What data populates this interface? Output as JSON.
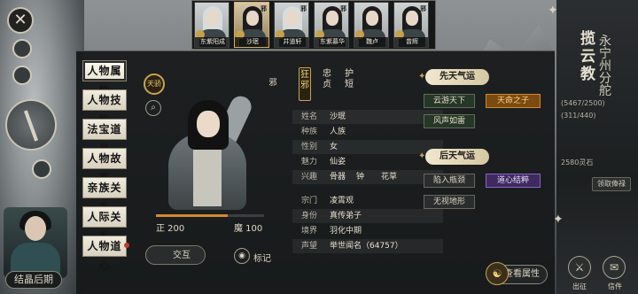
{
  "close_icon": "✕",
  "colors": {
    "gold": "#c8a44f",
    "panel": "#161819",
    "good_fortune": "#263627",
    "orange_fortune": "#7a4a10",
    "purple_fortune": "#3f2a5e"
  },
  "top_bar": {
    "characters": [
      {
        "name": "东紫阳成",
        "badge": "",
        "mark": "",
        "silver": true,
        "active": false
      },
      {
        "name": "沙珉",
        "badge": "",
        "mark": "邪",
        "silver": false,
        "active": true
      },
      {
        "name": "井道轩",
        "badge": "",
        "mark": "邪",
        "silver": true,
        "active": false
      },
      {
        "name": "东紫慕华",
        "badge": "",
        "mark": "邪",
        "silver": false,
        "active": false
      },
      {
        "name": "魏卢",
        "badge": "",
        "mark": "",
        "silver": false,
        "active": false
      },
      {
        "name": "曾辉",
        "badge": "",
        "mark": "邪",
        "silver": false,
        "active": false
      }
    ]
  },
  "tabs": [
    {
      "label": "人物属性",
      "active": true,
      "dot": false
    },
    {
      "label": "人物技能",
      "active": false,
      "dot": false
    },
    {
      "label": "法宝道具",
      "active": false,
      "dot": false
    },
    {
      "label": "人物故事",
      "active": false,
      "dot": false
    },
    {
      "label": "亲族关系",
      "active": false,
      "dot": false
    },
    {
      "label": "人际关系",
      "active": false,
      "dot": false
    },
    {
      "label": "人物道心",
      "active": false,
      "dot": true
    }
  ],
  "realm_seal": "天骄",
  "search_icon": "⌕",
  "portrait_alt": "character portrait",
  "alignment": {
    "good_label": "正 200",
    "evil_label": "魔 100",
    "good_value": 200,
    "evil_value": 100
  },
  "traits": [
    {
      "label": "狂邪",
      "selected": true
    },
    {
      "label": "忠贞",
      "selected": false
    },
    {
      "label": "护短",
      "selected": false
    }
  ],
  "evil_mark": "邪",
  "attributes": [
    {
      "key": "姓名",
      "value": "沙珉"
    },
    {
      "key": "种族",
      "value": "人族"
    },
    {
      "key": "性别",
      "value": "女"
    },
    {
      "key": "魅力",
      "value": "仙姿"
    },
    {
      "key": "兴趣",
      "value": "骨器",
      "value2": "钟",
      "value3": "花草"
    },
    {
      "key": "宗门",
      "value": "凌霄观"
    },
    {
      "key": "身份",
      "value": "真传弟子"
    },
    {
      "key": "境界",
      "value": "羽化中期"
    },
    {
      "key": "声望",
      "value": "举世闻名（64757）"
    }
  ],
  "fortune": {
    "innate_title": "先天气运",
    "acquired_title": "后天气运",
    "innate": [
      {
        "label": "云游天下",
        "style": "green"
      },
      {
        "label": "天命之子",
        "style": "orange"
      },
      {
        "label": "风声如雷",
        "style": "green"
      }
    ],
    "acquired": [
      {
        "label": "陷入瓶颈",
        "style": "gray"
      },
      {
        "label": "道心结粹",
        "style": "purple"
      },
      {
        "label": "无视地形",
        "style": "gray"
      }
    ]
  },
  "actions": {
    "interact": "交互",
    "mark": "标记",
    "view_attributes": "查看属性"
  },
  "bottom_left": {
    "label": "结晶后期"
  },
  "right_panel": {
    "title": "揽云教",
    "subtitle": "永宁州分舵",
    "stat1": "(5467/2500)",
    "stat2": "(311/440)",
    "stat3": "2580灵石",
    "buttons": [
      "",
      "",
      "领取俸禄"
    ]
  },
  "bottom_right": {
    "icon1_label": "出征",
    "icon2_label": "信件",
    "icon3_label": ""
  }
}
